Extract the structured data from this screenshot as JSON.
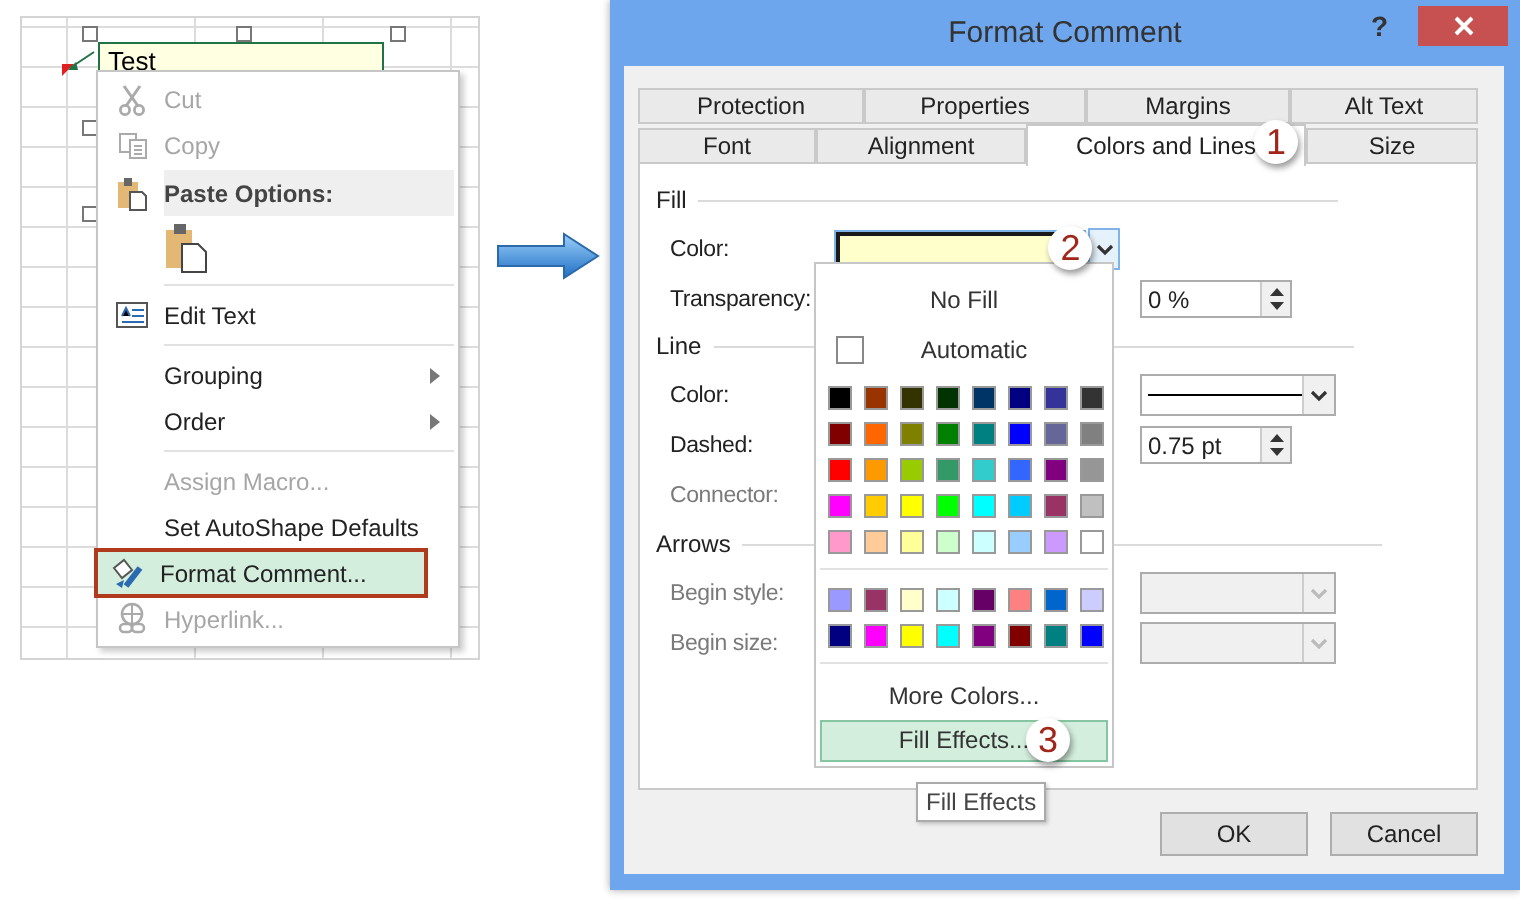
{
  "spreadsheet": {
    "comment_text": "Test"
  },
  "context_menu": {
    "items": [
      {
        "kind": "item",
        "label": "Cut",
        "disabled": true,
        "highlighted": false,
        "submenu": false
      },
      {
        "kind": "item",
        "label": "Copy",
        "disabled": true,
        "highlighted": false,
        "submenu": false
      },
      {
        "kind": "header",
        "label": "Paste Options:"
      },
      {
        "kind": "paste_option"
      },
      {
        "kind": "separator"
      },
      {
        "kind": "item",
        "label": "Edit Text",
        "disabled": false,
        "highlighted": false,
        "submenu": false
      },
      {
        "kind": "separator"
      },
      {
        "kind": "item",
        "label": "Grouping",
        "disabled": false,
        "highlighted": false,
        "submenu": true
      },
      {
        "kind": "item",
        "label": "Order",
        "disabled": false,
        "highlighted": false,
        "submenu": true
      },
      {
        "kind": "separator"
      },
      {
        "kind": "item",
        "label": "Assign Macro...",
        "disabled": true,
        "highlighted": false,
        "submenu": false
      },
      {
        "kind": "item",
        "label": "Set AutoShape Defaults",
        "disabled": false,
        "highlighted": false,
        "submenu": false
      },
      {
        "kind": "item",
        "label": "Format Comment...",
        "disabled": false,
        "highlighted": true,
        "submenu": false
      },
      {
        "kind": "item",
        "label": "Hyperlink...",
        "disabled": true,
        "highlighted": false,
        "submenu": false
      }
    ]
  },
  "dialog": {
    "title": "Format Comment",
    "help": "?",
    "tab_rows": [
      [
        {
          "label": "Protection",
          "selected": false
        },
        {
          "label": "Properties",
          "selected": false
        },
        {
          "label": "Margins",
          "selected": false
        },
        {
          "label": "Alt Text",
          "selected": false
        }
      ],
      [
        {
          "label": "Font",
          "selected": false
        },
        {
          "label": "Alignment",
          "selected": false
        },
        {
          "label": "Colors and Lines",
          "selected": true
        },
        {
          "label": "Size",
          "selected": false
        }
      ]
    ],
    "sections": [
      {
        "title": "Fill",
        "rows": [
          {
            "label": "Color:",
            "disabled": false,
            "middle": {
              "kind": "color_field",
              "color": "#ffffcc"
            }
          },
          {
            "label": "Transparency:",
            "disabled": false,
            "right": {
              "kind": "spin",
              "value": "0 %"
            }
          }
        ]
      },
      {
        "title": "Line",
        "rows": [
          {
            "label": "Color:",
            "disabled": false,
            "right": {
              "kind": "line_dropdown"
            }
          },
          {
            "label": "Dashed:",
            "disabled": false,
            "right": {
              "kind": "spin",
              "value": "0.75 pt"
            }
          },
          {
            "label": "Connector:",
            "disabled": true
          }
        ]
      },
      {
        "title": "Arrows",
        "rows": [
          {
            "label": "Begin style:",
            "disabled": true,
            "right": {
              "kind": "dropdown"
            }
          },
          {
            "label": "Begin size:",
            "disabled": true,
            "right": {
              "kind": "dropdown"
            }
          }
        ]
      }
    ],
    "palette": {
      "no_fill": "No Fill",
      "automatic": "Automatic",
      "groups": [
        [
          [
            {
              "color": "#000000"
            },
            {
              "color": "#993300"
            },
            {
              "color": "#333300"
            },
            {
              "color": "#003300"
            },
            {
              "color": "#003366"
            },
            {
              "color": "#000080"
            },
            {
              "color": "#333399"
            },
            {
              "color": "#333333"
            }
          ],
          [
            {
              "color": "#800000"
            },
            {
              "color": "#ff6600"
            },
            {
              "color": "#808000"
            },
            {
              "color": "#008000"
            },
            {
              "color": "#008080"
            },
            {
              "color": "#0000ff"
            },
            {
              "color": "#666699"
            },
            {
              "color": "#808080"
            }
          ],
          [
            {
              "color": "#ff0000"
            },
            {
              "color": "#ff9900"
            },
            {
              "color": "#99cc00"
            },
            {
              "color": "#339966"
            },
            {
              "color": "#33cccc"
            },
            {
              "color": "#3366ff"
            },
            {
              "color": "#800080"
            },
            {
              "color": "#969696"
            }
          ],
          [
            {
              "color": "#ff00ff"
            },
            {
              "color": "#ffcc00"
            },
            {
              "color": "#ffff00"
            },
            {
              "color": "#00ff00"
            },
            {
              "color": "#00ffff"
            },
            {
              "color": "#00ccff"
            },
            {
              "color": "#993366"
            },
            {
              "color": "#c0c0c0"
            }
          ],
          [
            {
              "color": "#ff99cc"
            },
            {
              "color": "#ffcc99"
            },
            {
              "color": "#ffff99"
            },
            {
              "color": "#ccffcc"
            },
            {
              "color": "#ccffff"
            },
            {
              "color": "#99ccff"
            },
            {
              "color": "#cc99ff"
            },
            {
              "color": "#ffffff"
            }
          ]
        ],
        [
          [
            {
              "color": "#9999ff"
            },
            {
              "color": "#993366"
            },
            {
              "color": "#ffffcc"
            },
            {
              "color": "#ccffff"
            },
            {
              "color": "#660066"
            },
            {
              "color": "#ff8080"
            },
            {
              "color": "#0066cc"
            },
            {
              "color": "#ccccff"
            }
          ],
          [
            {
              "color": "#000080"
            },
            {
              "color": "#ff00ff"
            },
            {
              "color": "#ffff00"
            },
            {
              "color": "#00ffff"
            },
            {
              "color": "#800080"
            },
            {
              "color": "#800000"
            },
            {
              "color": "#008080"
            },
            {
              "color": "#0000ff"
            }
          ]
        ]
      ],
      "more_colors": "More Colors...",
      "fill_effects": {
        "label": "Fill Effects...",
        "highlighted": true
      }
    },
    "tooltip": "Fill Effects",
    "buttons": [
      "OK",
      "Cancel"
    ]
  },
  "steps": [
    "1",
    "2",
    "3"
  ]
}
